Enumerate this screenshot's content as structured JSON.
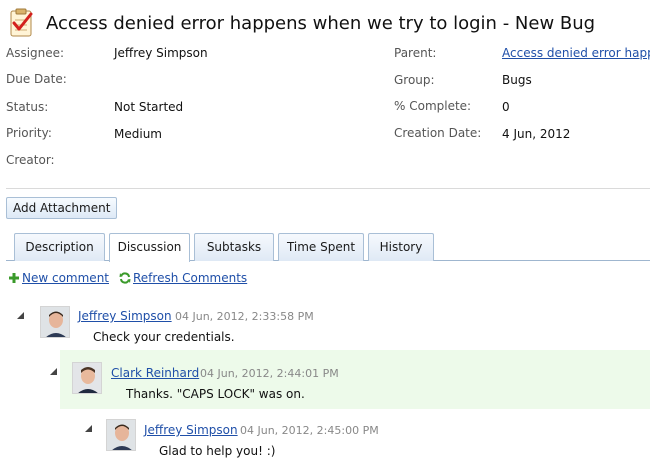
{
  "header": {
    "title": "Access denied error happens when we try to login - New Bug",
    "icon": "checklist-icon"
  },
  "properties": {
    "assignee_label": "Assignee:",
    "assignee_value": "Jeffrey Simpson",
    "due_date_label": "Due Date:",
    "due_date_value": "",
    "status_label": "Status:",
    "status_value": "Not Started",
    "priority_label": "Priority:",
    "priority_value": "Medium",
    "creator_label": "Creator:",
    "creator_value": "",
    "parent_label": "Parent:",
    "parent_value": "Access denied error happe",
    "group_label": "Group:",
    "group_value": "Bugs",
    "complete_label": "% Complete:",
    "complete_value": "0",
    "creation_date_label": "Creation Date:",
    "creation_date_value": "4 Jun, 2012"
  },
  "toolbar": {
    "add_attachment": "Add Attachment"
  },
  "tabs": [
    {
      "label": "Description",
      "active": false
    },
    {
      "label": "Discussion",
      "active": true
    },
    {
      "label": "Subtasks",
      "active": false
    },
    {
      "label": "Time Spent",
      "active": false
    },
    {
      "label": "History",
      "active": false
    }
  ],
  "discussion": {
    "new_comment": "New comment",
    "refresh_comments": "Refresh Comments",
    "comments": [
      {
        "author": "Jeffrey Simpson",
        "time": "04 Jun, 2012, 2:33:58 PM",
        "text": "Check your credentials."
      },
      {
        "author": "Clark Reinhard",
        "time": "04 Jun, 2012, 2:44:01 PM",
        "text": "Thanks. \"CAPS LOCK\" was on."
      },
      {
        "author": "Jeffrey Simpson",
        "time": "04 Jun, 2012, 2:45:00 PM",
        "text": "Glad to help you! :)"
      }
    ]
  },
  "colors": {
    "link": "#1f4fa8",
    "highlight": "#edfaea",
    "tab_border": "#a9bfd6"
  }
}
